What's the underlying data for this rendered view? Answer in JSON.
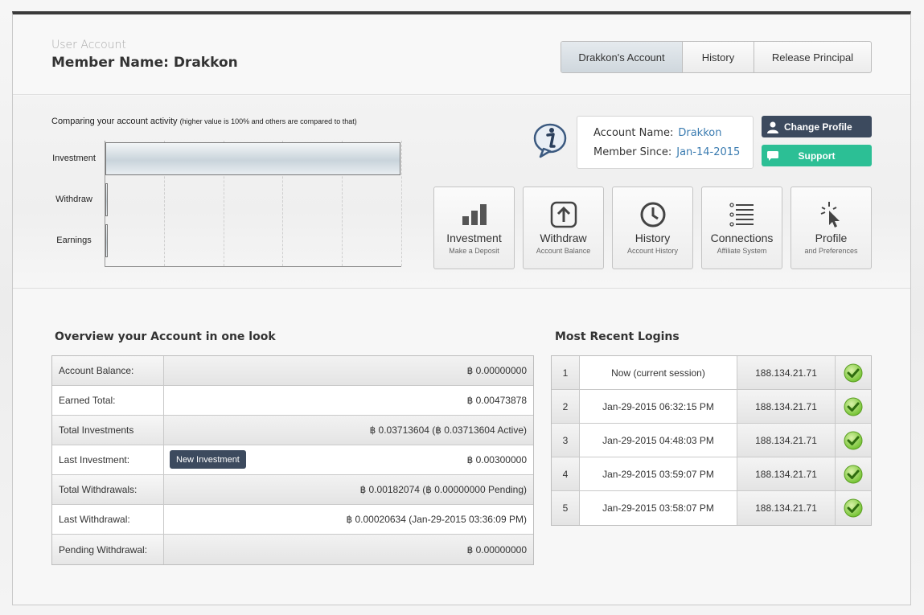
{
  "header": {
    "subtitle": "User Account",
    "member_label": "Member Name: Drakkon",
    "tabs": [
      {
        "label": "Drakkon's Account",
        "active": true
      },
      {
        "label": "History",
        "active": false
      },
      {
        "label": "Release Principal",
        "active": false
      }
    ]
  },
  "activity": {
    "title": "Comparing your account activity",
    "note": "(higher value is 100% and others are compared to that)",
    "chart_data": {
      "type": "bar",
      "orientation": "horizontal",
      "categories": [
        "Investment",
        "Withdraw",
        "Earnings"
      ],
      "values": [
        100,
        1,
        1
      ],
      "xlim": [
        0,
        100
      ],
      "grid": true
    }
  },
  "account_info": {
    "name_label": "Account Name:",
    "name_value": "Drakkon",
    "since_label": "Member Since:",
    "since_value": "Jan-14-2015"
  },
  "actions": {
    "change_profile": "Change Profile",
    "support": "Support"
  },
  "tiles": [
    {
      "title": "Investment",
      "sub": "Make a Deposit",
      "icon": "bar-chart-icon"
    },
    {
      "title": "Withdraw",
      "sub": "Account Balance",
      "icon": "upload-arrow-icon"
    },
    {
      "title": "History",
      "sub": "Account History",
      "icon": "clock-icon"
    },
    {
      "title": "Connections",
      "sub": "Affiliate System",
      "icon": "list-icon"
    },
    {
      "title": "Profile",
      "sub": "and Preferences",
      "icon": "cursor-click-icon"
    }
  ],
  "overview": {
    "title": "Overview your Account in one look",
    "new_investment_label": "New Investment",
    "rows": [
      {
        "label": "Account Balance:",
        "value": "฿ 0.00000000"
      },
      {
        "label": "Earned Total:",
        "value": "฿ 0.00473878"
      },
      {
        "label": "Total Investments",
        "value": "฿ 0.03713604 (฿ 0.03713604 Active)"
      },
      {
        "label": "Last Investment:",
        "value": "฿ 0.00300000"
      },
      {
        "label": "Total Withdrawals:",
        "value": "฿ 0.00182074 (฿ 0.00000000 Pending)"
      },
      {
        "label": "Last Withdrawal:",
        "value": "฿ 0.00020634 (Jan-29-2015 03:36:09 PM)"
      },
      {
        "label": "Pending Withdrawal:",
        "value": "฿ 0.00000000"
      }
    ]
  },
  "logins": {
    "title": "Most Recent Logins",
    "rows": [
      {
        "n": "1",
        "date": "Now (current session)",
        "ip": "188.134.21.71"
      },
      {
        "n": "2",
        "date": "Jan-29-2015 06:32:15 PM",
        "ip": "188.134.21.71"
      },
      {
        "n": "3",
        "date": "Jan-29-2015 04:48:03 PM",
        "ip": "188.134.21.71"
      },
      {
        "n": "4",
        "date": "Jan-29-2015 03:59:07 PM",
        "ip": "188.134.21.71"
      },
      {
        "n": "5",
        "date": "Jan-29-2015 03:58:07 PM",
        "ip": "188.134.21.71"
      }
    ]
  },
  "colors": {
    "dark_button": "#3c4a5e",
    "support_button": "#2cbf95",
    "link_blue": "#3a7bb0",
    "check_green": "#6cbf2a"
  }
}
